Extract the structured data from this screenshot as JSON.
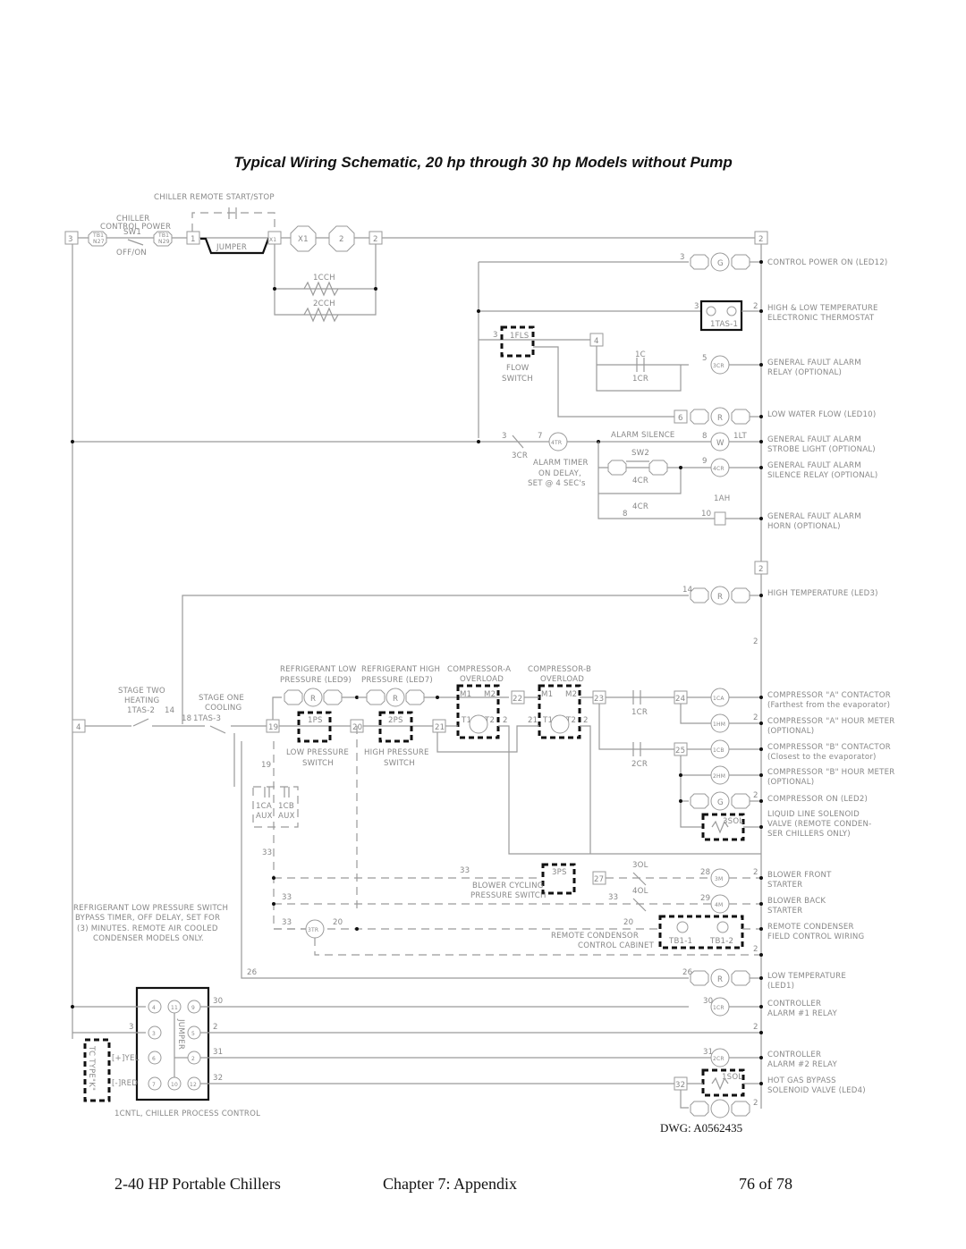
{
  "title": "Typical Wiring Schematic, 20 hp through 30 hp Models without Pump",
  "drawing_number": "DWG: A0562435",
  "footer": {
    "left": "2-40 HP Portable Chillers",
    "center": "Chapter 7: Appendix",
    "right": "76 of 78"
  },
  "top_section": {
    "remote_start": "CHILLER REMOTE START/STOP",
    "control_power_1": "CHILLER",
    "control_power_2": "CONTROL POWER",
    "sw1": "SW1",
    "offon": "OFF/ON",
    "jumper": "JUMPER",
    "x1": "X1",
    "two": "2",
    "cch1": "1CCH",
    "cch2": "2CCH",
    "tb1": "TB1",
    "n27": "N27",
    "n29": "N29",
    "t3": "3",
    "t1": "1"
  },
  "flow": {
    "fls": "1FLS",
    "flow1": "FLOW",
    "flow2": "SWITCH",
    "c1c": "1C",
    "c1cr": "1CR",
    "cr3": "3CR",
    "tr4": "4TR",
    "alarm_silence": "ALARM SILENCE",
    "sw2": "SW2",
    "timer1": "ALARM TIMER",
    "timer2": "ON DELAY,",
    "timer3": "SET @ 4 SEC's",
    "cr4": "4CR",
    "ah1": "1AH",
    "lt1": "1LT",
    "tas1": "1TAS-1"
  },
  "right_labels": [
    {
      "l1": "CONTROL POWER ON (LED12)",
      "l2": ""
    },
    {
      "l1": "HIGH & LOW TEMPERATURE",
      "l2": "ELECTRONIC THERMOSTAT"
    },
    {
      "l1": "GENERAL FAULT ALARM",
      "l2": "RELAY (OPTIONAL)"
    },
    {
      "l1": "LOW WATER FLOW (LED10)",
      "l2": ""
    },
    {
      "l1": "GENERAL FAULT ALARM",
      "l2": "STROBE LIGHT (OPTIONAL)"
    },
    {
      "l1": "GENERAL FAULT ALARM",
      "l2": "SILENCE RELAY (OPTIONAL)"
    },
    {
      "l1": "GENERAL FAULT ALARM",
      "l2": "HORN (OPTIONAL)"
    },
    {
      "l1": "HIGH TEMPERATURE (LED3)",
      "l2": ""
    },
    {
      "l1": "COMPRESSOR \"A\" CONTACTOR",
      "l2": "(Farthest from the evaporator)"
    },
    {
      "l1": "COMPRESSOR \"A\" HOUR METER",
      "l2": "(OPTIONAL)"
    },
    {
      "l1": "COMPRESSOR \"B\" CONTACTOR",
      "l2": "(Closest to the evaporator)"
    },
    {
      "l1": "COMPRESSOR \"B\" HOUR METER",
      "l2": "(OPTIONAL)"
    },
    {
      "l1": "COMPRESSOR ON (LED2)",
      "l2": ""
    },
    {
      "l1": "LIQUID LINE SOLENOID",
      "l2": "VALVE (REMOTE CONDEN-",
      "l3": "SER CHILLERS ONLY)"
    },
    {
      "l1": "BLOWER FRONT",
      "l2": "STARTER"
    },
    {
      "l1": "BLOWER BACK",
      "l2": "STARTER"
    },
    {
      "l1": "REMOTE CONDENSER",
      "l2": "FIELD CONTROL WIRING"
    },
    {
      "l1": "LOW TEMPERATURE",
      "l2": "(LED1)"
    },
    {
      "l1": "CONTROLLER",
      "l2": "ALARM #1 RELAY"
    },
    {
      "l1": "CONTROLLER",
      "l2": "ALARM #2 RELAY"
    },
    {
      "l1": "HOT GAS BYPASS",
      "l2": "SOLENOID VALVE (LED4)"
    }
  ],
  "compressor_section": {
    "stage_two_1": "STAGE TWO",
    "stage_two_2": "HEATING",
    "stage_two_3": "1TAS-2",
    "stage_one_1": "STAGE ONE",
    "stage_one_2": "COOLING",
    "stage_one_3": "1TAS-3",
    "ref_low_1": "REFRIGERANT LOW",
    "ref_low_2": "PRESSURE (LED9)",
    "ref_high_1": "REFRIGERANT HIGH",
    "ref_high_2": "PRESSURE (LED7)",
    "comp_a_1": "COMPRESSOR-A",
    "comp_b_1": "COMPRESSOR-B",
    "overload": "OVERLOAD",
    "ps1": "1PS",
    "ps2": "2PS",
    "low_ps_1": "LOW PRESSURE",
    "high_ps_1": "HIGH PRESSURE",
    "switch": "SWITCH",
    "m1": "M1",
    "m2": "M2",
    "t1": "T1",
    "t2": "T2",
    "cr1": "1CR",
    "cr2": "2CR",
    "ca1": "1CA",
    "cb1": "1CB",
    "hm1": "1HM",
    "hm2": "2HM",
    "aux": "AUX",
    "sol3": "3SOL",
    "ps3": "3PS",
    "blower1": "BLOWER CYCLING",
    "blower2": "PRESSURE SWITCH",
    "ol3": "3OL",
    "ol4": "4OL",
    "m3": "3M",
    "m4": "4M",
    "tr3": "3TR",
    "remote1": "REMOTE CONDENSOR",
    "remote2": "CONTROL CABINET",
    "tb11": "TB1-1",
    "tb12": "TB1-2",
    "bypass_note": [
      "REFRIGERANT LOW PRESSURE SWITCH",
      "BYPASS TIMER, OFF DELAY, SET FOR",
      "(3) MINUTES.  REMOTE AIR COOLED",
      "CONDENSER MODELS ONLY."
    ]
  },
  "controller": {
    "title": "1CNTL, CHILLER PROCESS CONTROL",
    "jumper": "JUMPER",
    "tc": "TC TYPE\"K\"",
    "yel": "[+]YEL",
    "red": "[-]RED",
    "cr1": "1CR",
    "cr2": "2CR",
    "sol1": "1SOL"
  }
}
